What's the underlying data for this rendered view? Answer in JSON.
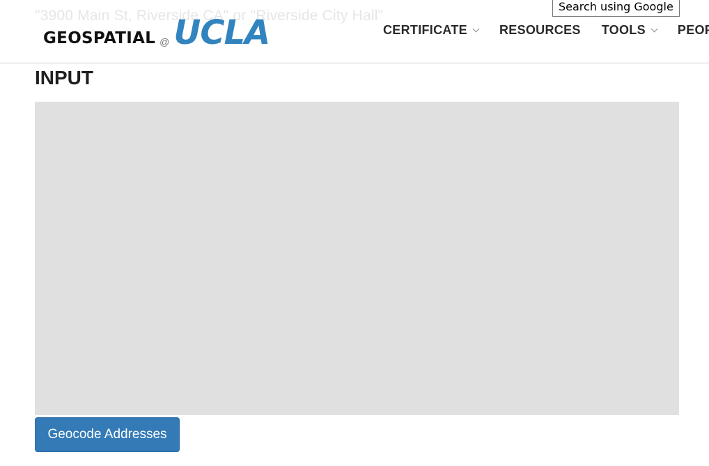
{
  "background": {
    "ghost_text": "\"3900 Main St, Riverside CA\" or \"Riverside City Hall\""
  },
  "header": {
    "logo": {
      "geospatial": "GEOSPATIAL",
      "at": "@",
      "ucla": "UCLA",
      "ucla_color": "#3284bf"
    },
    "search_hint": "Search using Google",
    "nav": [
      {
        "label": "CERTIFICATE",
        "has_dropdown": true
      },
      {
        "label": "RESOURCES",
        "has_dropdown": false
      },
      {
        "label": "TOOLS",
        "has_dropdown": true
      },
      {
        "label": "PEOPLE",
        "has_dropdown": false
      }
    ]
  },
  "main": {
    "section_title": "INPUT",
    "input_value": "",
    "button_label": "Geocode Addresses",
    "button_color": "#337ab7"
  }
}
